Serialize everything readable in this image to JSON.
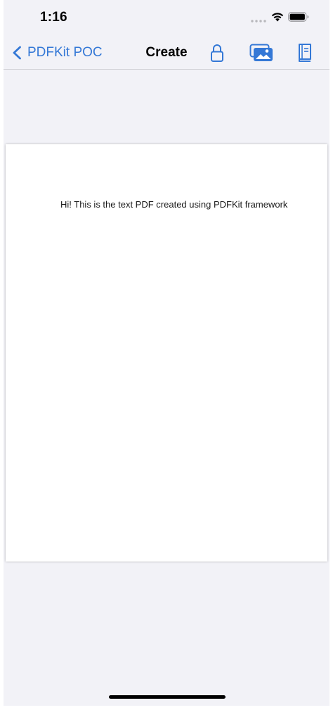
{
  "status_bar": {
    "time": "1:16",
    "signal_icon": "signal-dots-icon",
    "wifi_icon": "wifi-icon",
    "battery_icon": "battery-full-icon"
  },
  "nav_bar": {
    "back_label": "PDFKit POC",
    "title": "Create",
    "actions": [
      "lock-icon",
      "photos-icon",
      "book-icon"
    ]
  },
  "pdf_document": {
    "text": "Hi! This is the text PDF created using PDFKit framework"
  },
  "colors": {
    "accent": "#3478d6",
    "background": "#f2f2f7",
    "page": "#ffffff"
  }
}
